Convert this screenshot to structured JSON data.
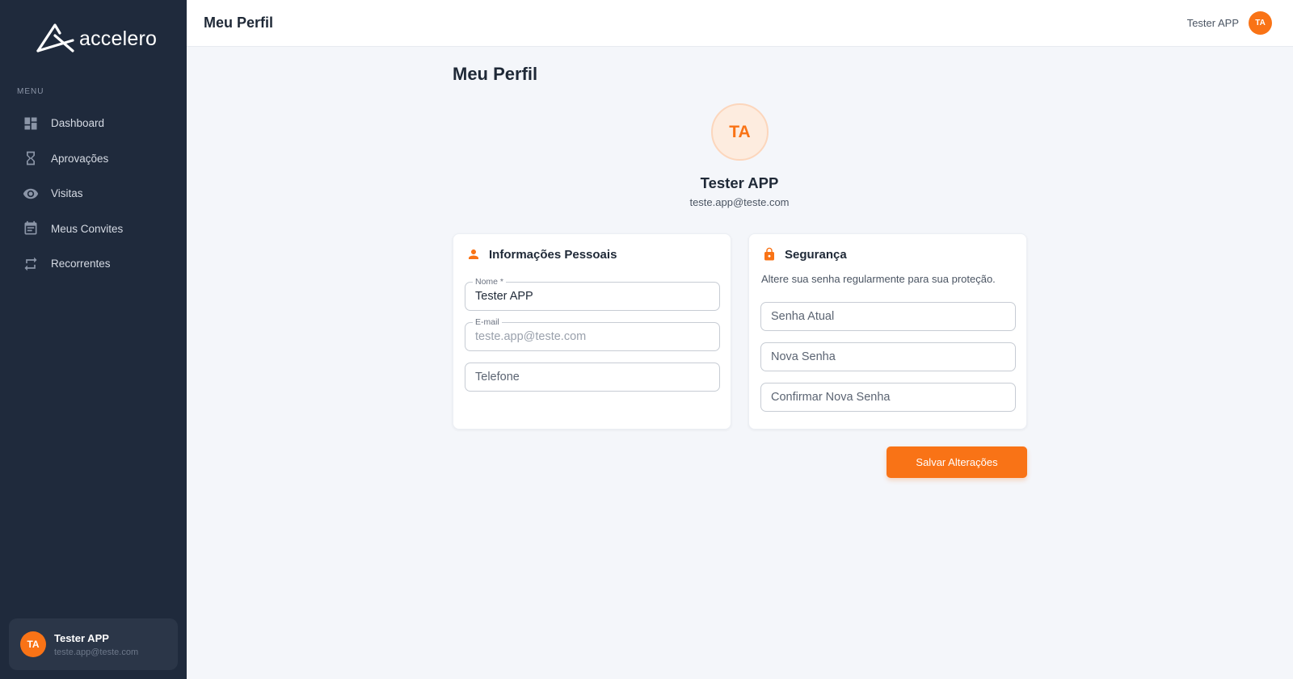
{
  "app": {
    "brand": "accelero"
  },
  "colors": {
    "accent": "#f97316",
    "sidebar": "#1f2a3c",
    "background": "#f4f6fa"
  },
  "sidebar": {
    "menu_label": "MENU",
    "items": [
      {
        "label": "Dashboard",
        "icon": "dashboard-icon"
      },
      {
        "label": "Aprovações",
        "icon": "hourglass-icon"
      },
      {
        "label": "Visitas",
        "icon": "eye-icon"
      },
      {
        "label": "Meus Convites",
        "icon": "calendar-icon"
      },
      {
        "label": "Recorrentes",
        "icon": "repeat-icon"
      }
    ],
    "user": {
      "initials": "TA",
      "name": "Tester APP",
      "email": "teste.app@teste.com"
    }
  },
  "header": {
    "title": "Meu Perfil",
    "user_name": "Tester APP",
    "user_initials": "TA"
  },
  "main": {
    "title": "Meu Perfil",
    "profile": {
      "initials": "TA",
      "name": "Tester APP",
      "email": "teste.app@teste.com"
    },
    "personal": {
      "title": "Informações Pessoais",
      "name_label": "Nome *",
      "name_value": "Tester APP",
      "email_label": "E-mail",
      "email_value": "teste.app@teste.com",
      "phone_placeholder": "Telefone"
    },
    "security": {
      "title": "Segurança",
      "subtitle": "Altere sua senha regularmente para sua proteção.",
      "current_placeholder": "Senha Atual",
      "new_placeholder": "Nova Senha",
      "confirm_placeholder": "Confirmar Nova Senha"
    },
    "save_label": "Salvar Alterações"
  }
}
